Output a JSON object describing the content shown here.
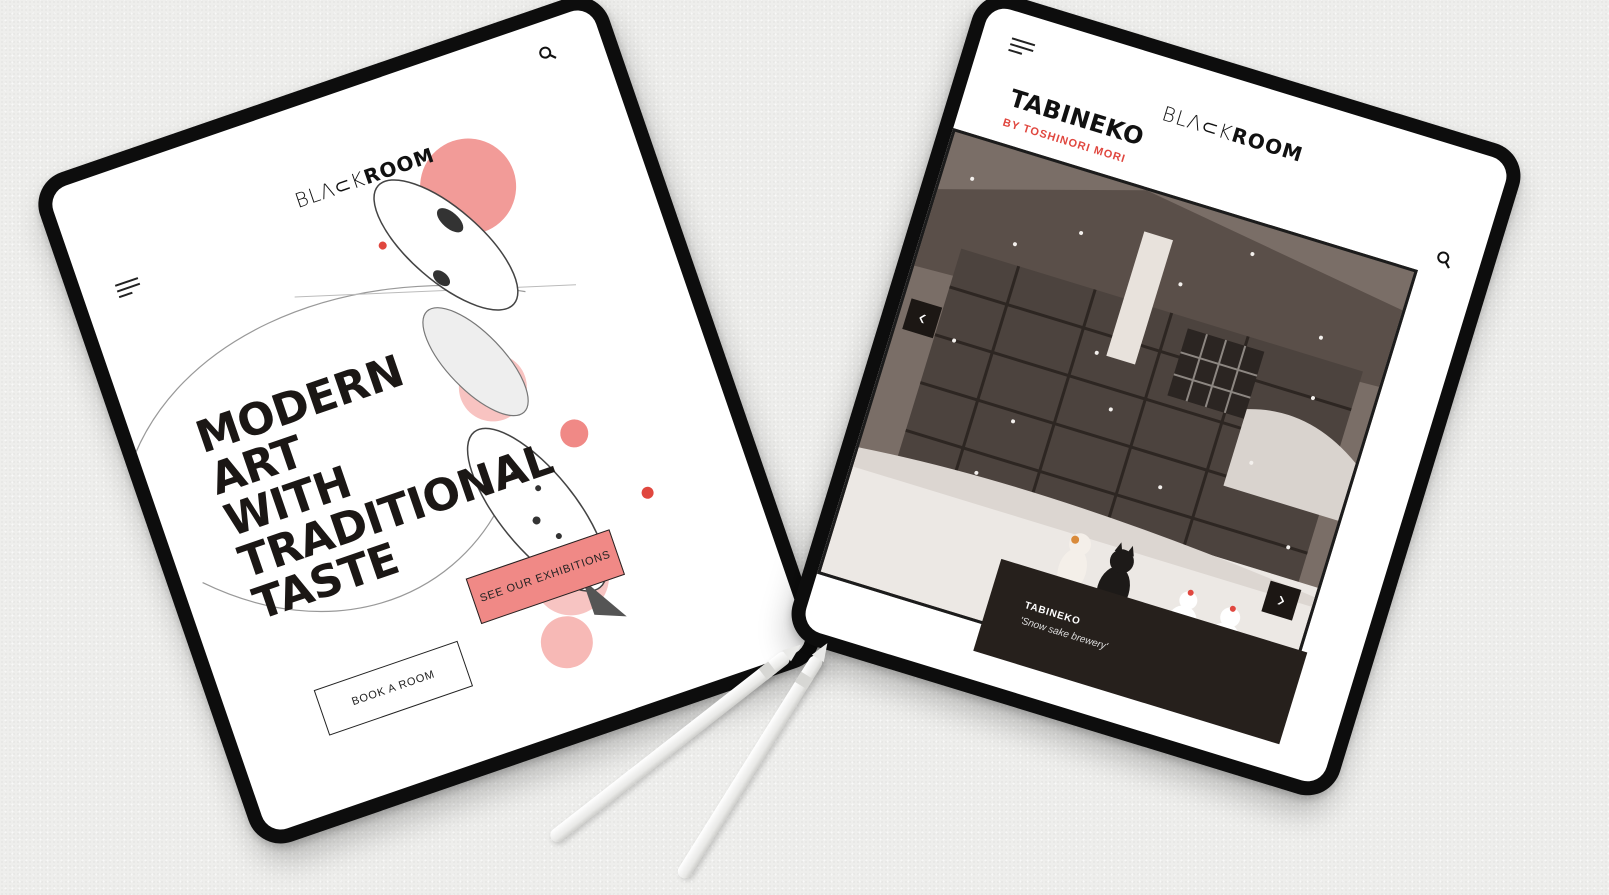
{
  "left_tablet": {
    "logo": {
      "part1": "BLΛ⊂K",
      "part2": "ROOM"
    },
    "hero_lines": [
      "MODERN ART",
      "WITH",
      "TRADITIONAL",
      "TASTE"
    ],
    "buttons": {
      "book": "BOOK A ROOM",
      "exhibitions": "SEE OUR EXHIBITIONS"
    },
    "icons": {
      "menu": "menu-icon",
      "search": "search-icon"
    }
  },
  "right_tablet": {
    "logo": {
      "part1": "BLΛ⊂K",
      "part2": "ROOM"
    },
    "title": "TABINEKO",
    "subtitle": "BY TOSHINORI MORI",
    "caption": {
      "title": "TABINEKO",
      "subtitle": "'Snow sake brewery'"
    },
    "carousel": {
      "prev": "‹",
      "next": "›"
    },
    "icons": {
      "menu": "menu-icon",
      "search": "search-icon"
    }
  },
  "colors": {
    "accent_pink": "#f08986",
    "accent_red": "#e0473f",
    "dark": "#26201c",
    "background": "#eeeeec"
  }
}
